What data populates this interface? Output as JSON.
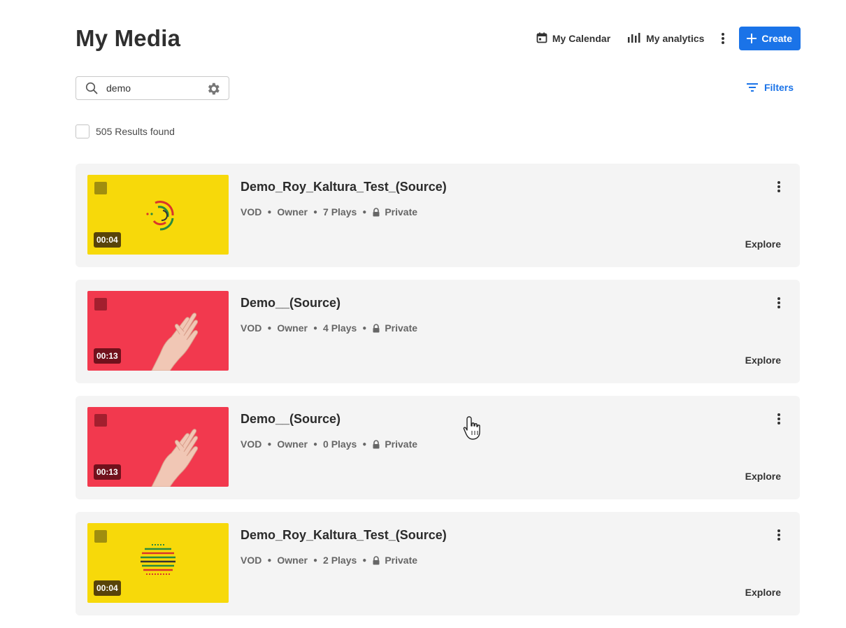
{
  "header": {
    "title": "My Media",
    "calendar_label": "My Calendar",
    "analytics_label": "My analytics",
    "create_label": "Create"
  },
  "search": {
    "value": "demo"
  },
  "filters_label": "Filters",
  "results_label": "505 Results found",
  "colors": {
    "accent": "#1a73e8",
    "thumb_yellow": "#f7d90a",
    "thumb_red": "#f2394e"
  },
  "media": [
    {
      "title": "Demo_Roy_Kaltura_Test_(Source)",
      "duration": "00:04",
      "type": "VOD",
      "role": "Owner",
      "plays": "7 Plays",
      "privacy": "Private",
      "explore": "Explore",
      "thumb": "yellow-rings"
    },
    {
      "title": "Demo__(Source)",
      "duration": "00:13",
      "type": "VOD",
      "role": "Owner",
      "plays": "4 Plays",
      "privacy": "Private",
      "explore": "Explore",
      "thumb": "red-hand"
    },
    {
      "title": "Demo__(Source)",
      "duration": "00:13",
      "type": "VOD",
      "role": "Owner",
      "plays": "0 Plays",
      "privacy": "Private",
      "explore": "Explore",
      "thumb": "red-hand"
    },
    {
      "title": "Demo_Roy_Kaltura_Test_(Source)",
      "duration": "00:04",
      "type": "VOD",
      "role": "Owner",
      "plays": "2 Plays",
      "privacy": "Private",
      "explore": "Explore",
      "thumb": "yellow-stripes"
    }
  ]
}
